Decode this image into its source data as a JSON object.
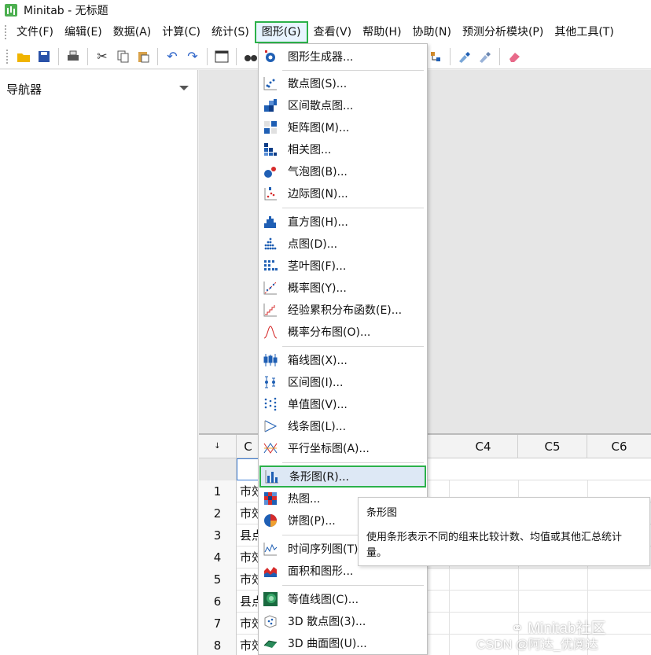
{
  "window": {
    "title": "Minitab - 无标题"
  },
  "menubar": {
    "items": [
      "文件(F)",
      "编辑(E)",
      "数据(A)",
      "计算(C)",
      "统计(S)",
      "图形(G)",
      "查看(V)",
      "帮助(H)",
      "协助(N)",
      "预测分析模块(P)",
      "其他工具(T)"
    ],
    "active": "图形(G)"
  },
  "navigator": {
    "title": "导航器"
  },
  "worksheet": {
    "corner": "↓",
    "col_c1_visible": "C",
    "columns": [
      "C4",
      "C5",
      "C6"
    ],
    "rows": [
      {
        "n": "1",
        "v": "市效"
      },
      {
        "n": "2",
        "v": "市效"
      },
      {
        "n": "3",
        "v": "县点"
      },
      {
        "n": "4",
        "v": "市效"
      },
      {
        "n": "5",
        "v": "市效"
      },
      {
        "n": "6",
        "v": "县点"
      },
      {
        "n": "7",
        "v": "市效"
      },
      {
        "n": "8",
        "v": "市效"
      }
    ]
  },
  "graph_menu": {
    "items": [
      {
        "label": "图形生成器...",
        "icon": "graph-builder-icon"
      },
      {
        "label": "散点图(S)...",
        "icon": "scatterplot-icon"
      },
      {
        "label": "区间散点图...",
        "icon": "binned-scatterplot-icon"
      },
      {
        "label": "矩阵图(M)...",
        "icon": "matrix-plot-icon"
      },
      {
        "label": "相关图...",
        "icon": "correlogram-icon"
      },
      {
        "label": "气泡图(B)...",
        "icon": "bubble-plot-icon"
      },
      {
        "label": "边际图(N)...",
        "icon": "marginal-plot-icon"
      },
      {
        "label": "直方图(H)...",
        "icon": "histogram-icon"
      },
      {
        "label": "点图(D)...",
        "icon": "dotplot-icon"
      },
      {
        "label": "茎叶图(F)...",
        "icon": "stem-leaf-icon"
      },
      {
        "label": "概率图(Y)...",
        "icon": "probability-plot-icon"
      },
      {
        "label": "经验累积分布函数(E)...",
        "icon": "ecdf-icon"
      },
      {
        "label": "概率分布图(O)...",
        "icon": "distribution-plot-icon"
      },
      {
        "label": "箱线图(X)...",
        "icon": "boxplot-icon"
      },
      {
        "label": "区间图(I)...",
        "icon": "interval-plot-icon"
      },
      {
        "label": "单值图(V)...",
        "icon": "individual-value-plot-icon"
      },
      {
        "label": "线条图(L)...",
        "icon": "line-plot-icon"
      },
      {
        "label": "平行坐标图(A)...",
        "icon": "parallel-coordinates-icon"
      },
      {
        "label": "条形图(R)...",
        "icon": "bar-chart-icon"
      },
      {
        "label": "热图...",
        "icon": "heatmap-icon"
      },
      {
        "label": "饼图(P)...",
        "icon": "pie-chart-icon"
      },
      {
        "label": "时间序列图(T)...",
        "icon": "time-series-icon"
      },
      {
        "label": "面积和图形...",
        "icon": "area-graph-icon"
      },
      {
        "label": "等值线图(C)...",
        "icon": "contour-plot-icon"
      },
      {
        "label": "3D 散点图(3)...",
        "icon": "3d-scatterplot-icon"
      },
      {
        "label": "3D 曲面图(U)...",
        "icon": "3d-surface-icon"
      }
    ],
    "highlighted": "条形图(R)..."
  },
  "tooltip": {
    "title": "条形图",
    "body": "使用条形表示不同的组来比较计数、均值或其他汇总统计量。"
  },
  "watermark": {
    "line1": "Minitab社区",
    "line2": "CSDN @阿达_优阅达"
  },
  "colors": {
    "highlight_border": "#2bb14a",
    "icon_blue": "#1f5fb4",
    "accent_red": "#d62b2b"
  }
}
